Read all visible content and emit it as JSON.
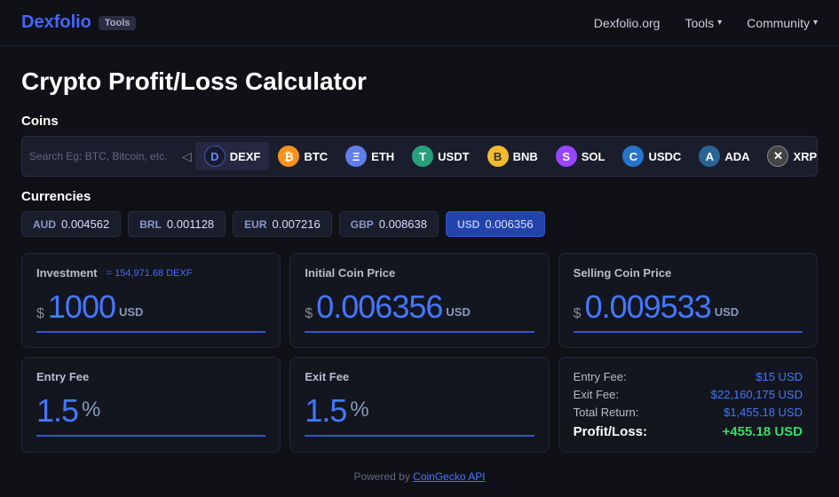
{
  "nav": {
    "logo_main": "Dexfolio",
    "logo_accent": "",
    "tools_badge": "Tools",
    "links": [
      {
        "label": "Dexfolio.org",
        "has_chevron": false
      },
      {
        "label": "Tools",
        "has_chevron": true
      },
      {
        "label": "Community",
        "has_chevron": true
      }
    ]
  },
  "page": {
    "title": "Crypto Profit/Loss Calculator"
  },
  "coins_section": {
    "label": "Coins",
    "search_placeholder": "Search Eg: BTC, Bitcoin, etc.",
    "coins": [
      {
        "symbol": "DEXF",
        "icon_text": "D",
        "icon_class": "coin-dexf",
        "active": true
      },
      {
        "symbol": "BTC",
        "icon_text": "₿",
        "icon_class": "coin-btc",
        "active": false
      },
      {
        "symbol": "ETH",
        "icon_text": "Ξ",
        "icon_class": "coin-eth",
        "active": false
      },
      {
        "symbol": "USDT",
        "icon_text": "T",
        "icon_class": "coin-usdt",
        "active": false
      },
      {
        "symbol": "BNB",
        "icon_text": "B",
        "icon_class": "coin-bnb",
        "active": false
      },
      {
        "symbol": "SOL",
        "icon_text": "S",
        "icon_class": "coin-sol",
        "active": false
      },
      {
        "symbol": "USDC",
        "icon_text": "C",
        "icon_class": "coin-usdc",
        "active": false
      },
      {
        "symbol": "ADA",
        "icon_text": "A",
        "icon_class": "coin-ada",
        "active": false
      },
      {
        "symbol": "XRP",
        "icon_text": "✕",
        "icon_class": "coin-xrp",
        "active": false
      }
    ]
  },
  "currencies_section": {
    "label": "Currencies",
    "currencies": [
      {
        "code": "AUD",
        "value": "0.004562",
        "active": false
      },
      {
        "code": "BRL",
        "value": "0.001128",
        "active": false
      },
      {
        "code": "EUR",
        "value": "0.007216",
        "active": false
      },
      {
        "code": "GBP",
        "value": "0.008638",
        "active": false
      },
      {
        "code": "USD",
        "value": "0.006356",
        "active": true
      }
    ]
  },
  "calculator": {
    "investment": {
      "label": "Investment",
      "equiv": "= 154,971.68 DEXF",
      "dollar_sign": "$",
      "value": "1000",
      "currency": "USD"
    },
    "initial_price": {
      "label": "Initial Coin Price",
      "dollar_sign": "$",
      "value": "0.006356",
      "currency": "USD"
    },
    "selling_price": {
      "label": "Selling Coin Price",
      "dollar_sign": "$",
      "value": "0.009533",
      "currency": "USD"
    },
    "entry_fee": {
      "label": "Entry Fee",
      "value": "1.5",
      "percent": "%"
    },
    "exit_fee": {
      "label": "Exit Fee",
      "value": "1.5",
      "percent": "%"
    },
    "results": {
      "entry_fee_label": "Entry Fee:",
      "entry_fee_value": "$15 USD",
      "exit_fee_label": "Exit Fee:",
      "exit_fee_value": "$22,160,175 USD",
      "total_return_label": "Total Return:",
      "total_return_value": "$1,455.18 USD",
      "profit_label": "Profit/Loss:",
      "profit_value": "+455.18 USD"
    }
  },
  "footer": {
    "text": "Powered by ",
    "link_text": "CoinGecko API"
  }
}
